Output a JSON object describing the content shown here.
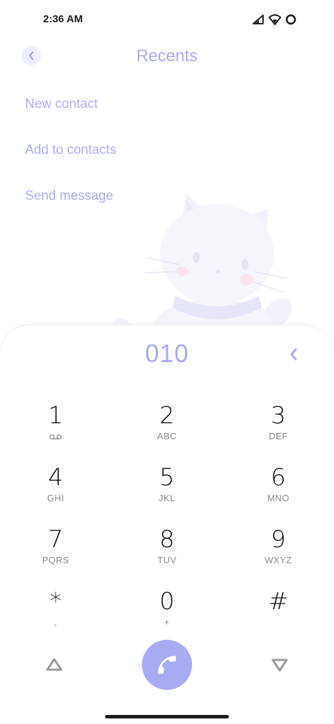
{
  "status": {
    "time": "2:36 AM",
    "icons": [
      "signal-icon",
      "wifi-icon",
      "battery-icon"
    ]
  },
  "header": {
    "title": "Recents",
    "back_icon": "chevron-left-icon"
  },
  "menu": {
    "items": [
      {
        "label": "New contact"
      },
      {
        "label": "Add to contacts"
      },
      {
        "label": "Send message"
      }
    ]
  },
  "dialer": {
    "number": "010",
    "backspace_icon": "backspace-icon",
    "keys": [
      {
        "digit": "1",
        "letters": ""
      },
      {
        "digit": "2",
        "letters": "ABC"
      },
      {
        "digit": "3",
        "letters": "DEF"
      },
      {
        "digit": "4",
        "letters": "GHI"
      },
      {
        "digit": "5",
        "letters": "JKL"
      },
      {
        "digit": "6",
        "letters": "MNO"
      },
      {
        "digit": "7",
        "letters": "PQRS"
      },
      {
        "digit": "8",
        "letters": "TUV"
      },
      {
        "digit": "9",
        "letters": "WXYZ"
      },
      {
        "digit": "*",
        "letters": ","
      },
      {
        "digit": "0",
        "letters": "+"
      },
      {
        "digit": "#",
        "letters": ""
      }
    ]
  },
  "colors": {
    "accent": "#a8abf2",
    "accent_light": "#eeeefb",
    "text_dark": "#111111",
    "text_muted": "#8a8a8a"
  }
}
